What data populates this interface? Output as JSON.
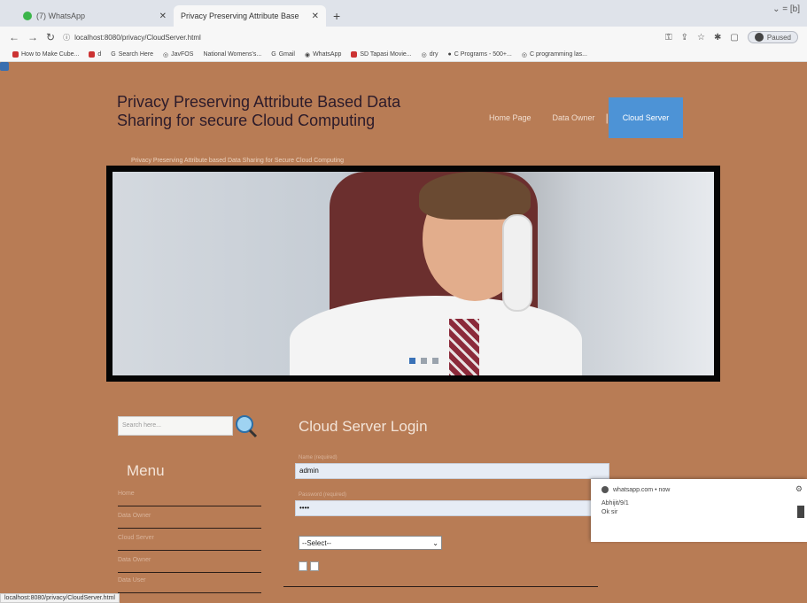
{
  "browser": {
    "tabs": [
      {
        "title": "(7) WhatsApp",
        "active": false
      },
      {
        "title": "Privacy Preserving Attribute Base",
        "active": true
      }
    ],
    "new_tab": "+",
    "window_controls": "⌄  = [b]",
    "url": "localhost:8080/privacy/CloudServer.html",
    "profile_label": "Paused",
    "bookmarks": [
      "How to Make Cube...",
      "d",
      "Search Here",
      "JavFOS",
      "National Womens's...",
      "Gmail",
      "WhatsApp",
      "SD Tapasi Movie...",
      "dry",
      "C Programs - 500+...",
      "C programming las..."
    ]
  },
  "site": {
    "title": "Privacy Preserving Attribute Based Data Sharing for secure Cloud Computing",
    "subtitle": "Privacy Preserving Attribute based Data Sharing for Secure Cloud Computing",
    "nav": [
      {
        "label": "Home Page",
        "active": false
      },
      {
        "label": "Data Owner",
        "active": false
      },
      {
        "label": "Cloud Server",
        "active": true
      }
    ],
    "nav_separator": "|"
  },
  "sidebar": {
    "search_placeholder": "Search here...",
    "menu_title": "Menu",
    "menu_items": [
      "Home",
      "Data Owner",
      "Cloud Server",
      "Data Owner",
      "Data User"
    ]
  },
  "login": {
    "title": "Cloud Server Login",
    "username_label": "Name (required)",
    "username_value": "admin",
    "password_label": "Password (required)",
    "password_value": "••••",
    "select_value": "--Select--"
  },
  "notification": {
    "source": "whatsapp.com • now",
    "line1": "Abhijit/9/1",
    "line2": "Ok sir"
  },
  "status_bar": "localhost:8080/privacy/CloudServer.html"
}
